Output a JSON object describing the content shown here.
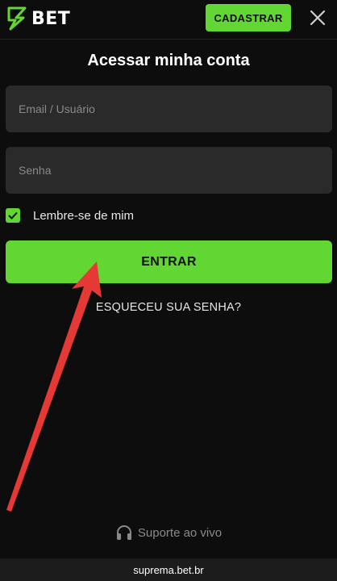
{
  "header": {
    "logo_text": "BET",
    "register_label": "CADASTRAR",
    "close_icon": "close-icon"
  },
  "login": {
    "title": "Acessar minha conta",
    "email_placeholder": "Email / Usuário",
    "password_placeholder": "Senha",
    "remember_label": "Lembre-se de mim",
    "remember_checked": true,
    "submit_label": "ENTRAR",
    "forgot_label": "ESQUECEU SUA SENHA?"
  },
  "support": {
    "label": "Suporte ao vivo",
    "icon": "headphones-icon"
  },
  "footer": {
    "domain": "suprema.bet.br"
  },
  "colors": {
    "accent": "#62d633",
    "background": "#0d0d0d",
    "field_bg": "#2a2a2a",
    "annotation_arrow": "#e53935"
  }
}
